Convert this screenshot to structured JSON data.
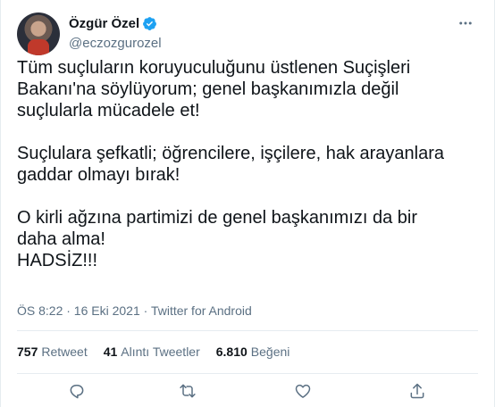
{
  "author": {
    "display_name": "Özgür Özel",
    "handle": "@eczozgurozel",
    "verified": true
  },
  "tweet": {
    "paragraphs": [
      [
        "Tüm suçluların koruyuculuğunu üstlenen Suçişleri",
        "Bakanı'na söylüyorum; genel başkanımızla değil",
        "suçlularla mücadele et!"
      ],
      [
        "Suçlulara şefkatli; öğrencilere, işçilere, hak arayanlara",
        "gaddar olmayı bırak!"
      ],
      [
        "O kirli ağzına partimizi de genel başkanımızı da bir",
        "daha alma!",
        "HADSİZ!!!"
      ]
    ],
    "timestamp": "ÖS 8:22 · 16 Eki 2021 · Twitter for Android"
  },
  "stats": {
    "retweets_count": "757",
    "retweets_label": "Retweet",
    "quotes_count": "41",
    "quotes_label": "Alıntı Tweetler",
    "likes_count": "6.810",
    "likes_label": "Beğeni"
  },
  "icons": {
    "verified": "verified-badge-icon",
    "more": "more-icon",
    "reply": "reply-icon",
    "retweet": "retweet-icon",
    "like": "like-icon",
    "share": "share-icon"
  },
  "colors": {
    "verified_blue": "#1da1f2",
    "secondary_text": "#5b7083",
    "primary_text": "#0f1419",
    "divider": "#e6ecf0"
  }
}
